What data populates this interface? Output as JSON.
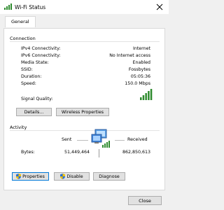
{
  "window": {
    "title": "Wi-Fi Status"
  },
  "tabs": [
    {
      "label": "General"
    }
  ],
  "connection": {
    "heading": "Connection",
    "rows": [
      {
        "label": "IPv4 Connectivity:",
        "value": "Internet"
      },
      {
        "label": "IPv6 Connectivity:",
        "value": "No Internet access"
      },
      {
        "label": "Media State:",
        "value": "Enabled"
      },
      {
        "label": "SSID:",
        "value": "Fossbytes"
      },
      {
        "label": "Duration:",
        "value": "05:05:36"
      },
      {
        "label": "Speed:",
        "value": "150.0 Mbps"
      }
    ],
    "signal_label": "Signal Quality:",
    "signal_bars_lit": 5,
    "signal_bars_total": 5,
    "details_button": "Details...",
    "wireless_button": "Wireless Properties"
  },
  "activity": {
    "heading": "Activity",
    "sent_label": "Sent",
    "received_label": "Received",
    "bytes_label": "Bytes:",
    "bytes_sent": "51,449,464",
    "bytes_received": "862,850,613"
  },
  "buttons": {
    "properties": "Properties",
    "disable": "Disable",
    "diagnose": "Diagnose",
    "close": "Close"
  },
  "colors": {
    "signal_green": "#2e8b2e",
    "accent_blue": "#0078d7",
    "shield_blue": "#2a6fd6",
    "shield_yellow": "#f2c200"
  },
  "icons": [
    "wifi-status-icon",
    "close-icon",
    "signal-bars-icon",
    "network-computers-icon",
    "uac-shield-icon"
  ]
}
